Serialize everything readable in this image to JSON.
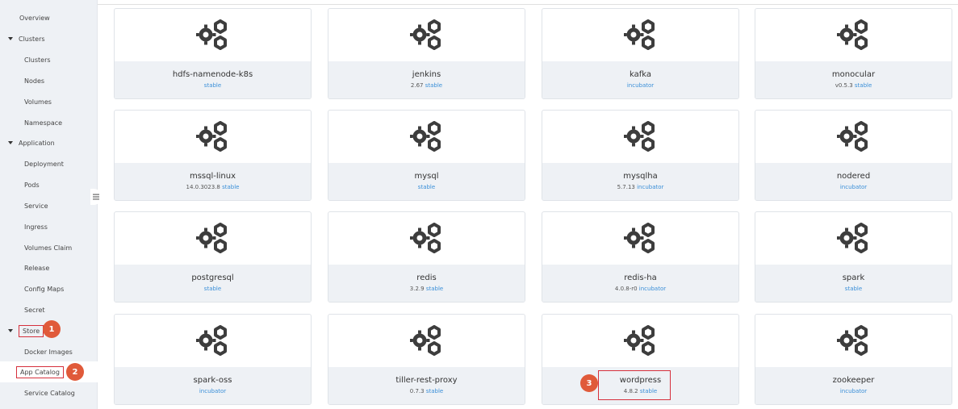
{
  "sidebar": {
    "items": [
      {
        "label": "Overview",
        "type": "sub"
      },
      {
        "label": "Clusters",
        "type": "section"
      },
      {
        "label": "Clusters",
        "type": "sub"
      },
      {
        "label": "Nodes",
        "type": "sub"
      },
      {
        "label": "Volumes",
        "type": "sub"
      },
      {
        "label": "Namespace",
        "type": "sub"
      },
      {
        "label": "Application",
        "type": "section"
      },
      {
        "label": "Deployment",
        "type": "sub"
      },
      {
        "label": "Pods",
        "type": "sub"
      },
      {
        "label": "Service",
        "type": "sub"
      },
      {
        "label": "Ingress",
        "type": "sub"
      },
      {
        "label": "Volumes Claim",
        "type": "sub"
      },
      {
        "label": "Release",
        "type": "sub"
      },
      {
        "label": "Config Maps",
        "type": "sub"
      },
      {
        "label": "Secret",
        "type": "sub"
      },
      {
        "label": "Store",
        "type": "section"
      },
      {
        "label": "Docker Images",
        "type": "sub"
      },
      {
        "label": "App Catalog",
        "type": "sub"
      },
      {
        "label": "Service Catalog",
        "type": "sub"
      }
    ]
  },
  "annotations": {
    "step1": "1",
    "step2": "2",
    "step3": "3"
  },
  "charts": [
    {
      "name": "hdfs-namenode-k8s",
      "version": "",
      "repo": "stable"
    },
    {
      "name": "jenkins",
      "version": "2.67",
      "repo": "stable"
    },
    {
      "name": "kafka",
      "version": "",
      "repo": "incubator"
    },
    {
      "name": "monocular",
      "version": "v0.5.3",
      "repo": "stable"
    },
    {
      "name": "mssql-linux",
      "version": "14.0.3023.8",
      "repo": "stable"
    },
    {
      "name": "mysql",
      "version": "",
      "repo": "stable"
    },
    {
      "name": "mysqlha",
      "version": "5.7.13",
      "repo": "incubator"
    },
    {
      "name": "nodered",
      "version": "",
      "repo": "incubator"
    },
    {
      "name": "postgresql",
      "version": "",
      "repo": "stable"
    },
    {
      "name": "redis",
      "version": "3.2.9",
      "repo": "stable"
    },
    {
      "name": "redis-ha",
      "version": "4.0.8-r0",
      "repo": "incubator"
    },
    {
      "name": "spark",
      "version": "",
      "repo": "stable"
    },
    {
      "name": "spark-oss",
      "version": "",
      "repo": "incubator"
    },
    {
      "name": "tiller-rest-proxy",
      "version": "0.7.3",
      "repo": "stable"
    },
    {
      "name": "wordpress",
      "version": "4.8.2",
      "repo": "stable"
    },
    {
      "name": "zookeeper",
      "version": "",
      "repo": "incubator"
    }
  ],
  "icons": {
    "chart": "gears-icon",
    "collapse": "menu-icon"
  },
  "colors": {
    "accent": "#3a8fd8",
    "highlight": "#d6303c",
    "badge": "#e05a3a"
  }
}
